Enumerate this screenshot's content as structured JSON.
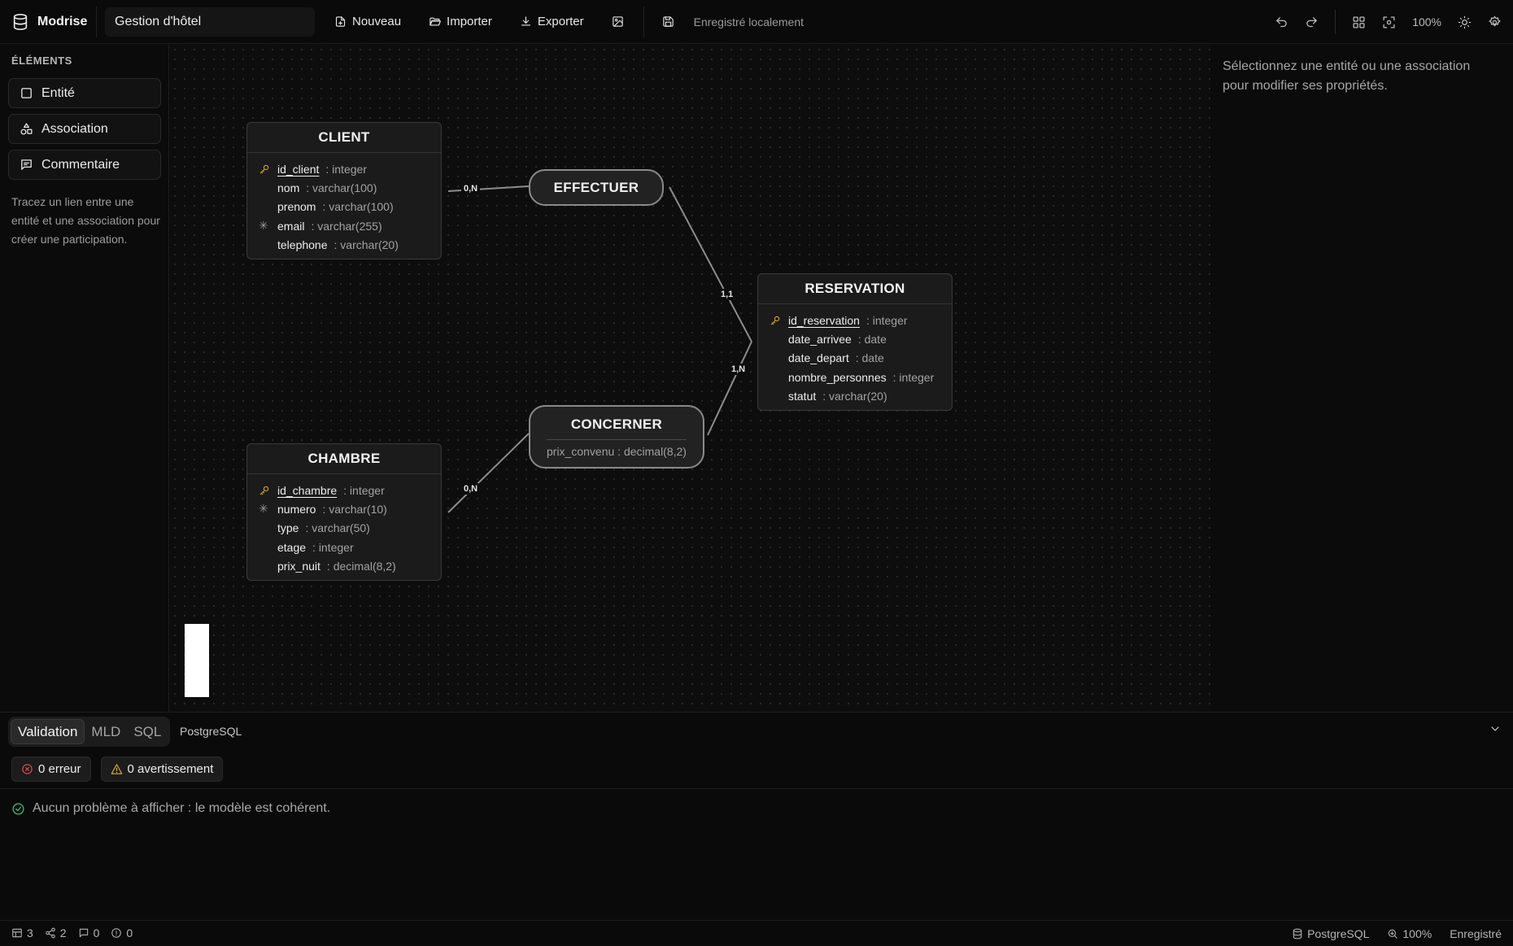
{
  "app": {
    "name": "Modrise",
    "document_title": "Gestion d'hôtel"
  },
  "toolbar": {
    "new_label": "Nouveau",
    "import_label": "Importer",
    "export_label": "Exporter",
    "save_status": "Enregistré localement",
    "zoom": "100%"
  },
  "sidebar": {
    "section_title": "ÉLÉMENTS",
    "tools": [
      {
        "label": "Entité",
        "icon": "square-icon"
      },
      {
        "label": "Association",
        "icon": "shapes-icon"
      },
      {
        "label": "Commentaire",
        "icon": "comment-icon"
      }
    ],
    "hint": "Tracez un lien entre une entité et une association pour créer une participation."
  },
  "diagram": {
    "entities": [
      {
        "name": "CLIENT",
        "attributes": [
          {
            "marker": "key",
            "name": "id_client",
            "type": ": integer",
            "pk": true
          },
          {
            "marker": "",
            "name": "nom",
            "type": ": varchar(100)"
          },
          {
            "marker": "",
            "name": "prenom",
            "type": ": varchar(100)"
          },
          {
            "marker": "✳",
            "name": "email",
            "type": ": varchar(255)"
          },
          {
            "marker": "",
            "name": "telephone",
            "type": ": varchar(20)"
          }
        ]
      },
      {
        "name": "RESERVATION",
        "attributes": [
          {
            "marker": "key",
            "name": "id_reservation",
            "type": ": integer",
            "pk": true
          },
          {
            "marker": "",
            "name": "date_arrivee",
            "type": ": date"
          },
          {
            "marker": "",
            "name": "date_depart",
            "type": ": date"
          },
          {
            "marker": "",
            "name": "nombre_personnes",
            "type": ": integer"
          },
          {
            "marker": "",
            "name": "statut",
            "type": ": varchar(20)"
          }
        ]
      },
      {
        "name": "CHAMBRE",
        "attributes": [
          {
            "marker": "key",
            "name": "id_chambre",
            "type": ": integer",
            "pk": true
          },
          {
            "marker": "✳",
            "name": "numero",
            "type": ": varchar(10)"
          },
          {
            "marker": "",
            "name": "type",
            "type": ": varchar(50)"
          },
          {
            "marker": "",
            "name": "etage",
            "type": ": integer"
          },
          {
            "marker": "",
            "name": "prix_nuit",
            "type": ": decimal(8,2)"
          }
        ]
      }
    ],
    "associations": [
      {
        "name": "EFFECTUER",
        "attribute": ""
      },
      {
        "name": "CONCERNER",
        "attribute": "prix_convenu : decimal(8,2)"
      }
    ],
    "cardinalities": {
      "client_effectuer": "0,N",
      "effectuer_reservation": "1,1",
      "concerner_reservation": "1,N",
      "chambre_concerner": "0,N"
    }
  },
  "right_panel": {
    "placeholder": "Sélectionnez une entité ou une association pour modifier ses propriétés."
  },
  "bottom": {
    "tabs": [
      "Validation",
      "MLD",
      "SQL"
    ],
    "active_tab": "Validation",
    "dialect": "PostgreSQL",
    "errors_label": "0 erreur",
    "warnings_label": "0 avertissement",
    "message": "Aucun problème à afficher : le modèle est cohérent."
  },
  "statusbar": {
    "entities_count": "3",
    "associations_count": "2",
    "comments_count": "0",
    "issues_count": "0",
    "dialect": "PostgreSQL",
    "zoom": "100%",
    "save_state": "Enregistré"
  },
  "colors": {
    "key_icon": "#d4a72c",
    "success": "#36c07a",
    "error": "#e05252",
    "warning": "#e2b33c"
  }
}
